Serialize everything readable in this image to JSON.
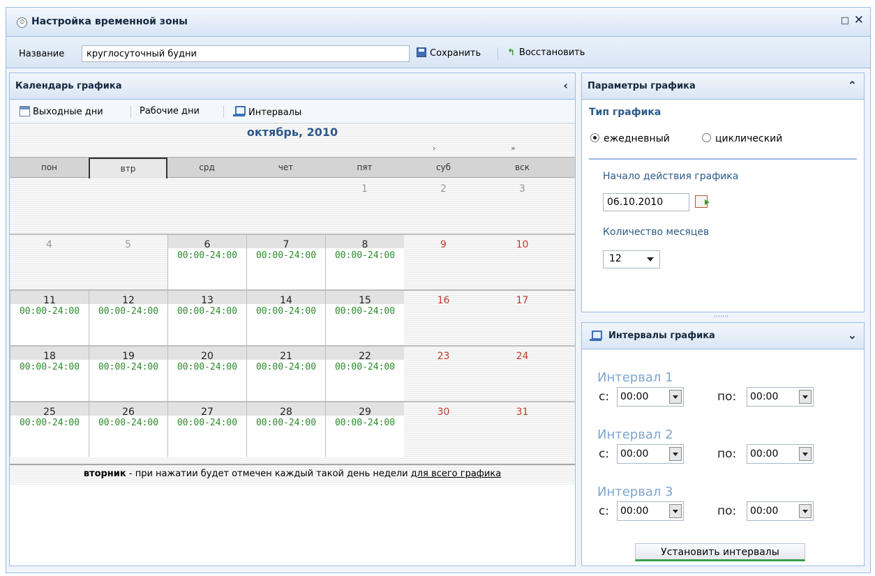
{
  "window": {
    "title": "Настройка временной зоны"
  },
  "toolbar": {
    "name_label": "Название",
    "name_value": "круглосуточный будни",
    "save_label": "Сохранить",
    "restore_label": "Восстановить"
  },
  "calendar_panel": {
    "title": "Календарь графика",
    "tabs": {
      "weekends": "Выходные дни",
      "workdays": "Рабочие дни",
      "intervals": "Интервалы"
    },
    "month": "октябрь, 2010",
    "nav_next": "›",
    "nav_next_year": "»",
    "weekdays": [
      "пон",
      "втр",
      "срд",
      "чет",
      "пят",
      "суб",
      "вск"
    ],
    "selected_weekday_index": 1,
    "rows": [
      [
        {
          "d": "",
          "t": "",
          "k": "empty"
        },
        {
          "d": "",
          "t": "",
          "k": "empty"
        },
        {
          "d": "",
          "t": "",
          "k": "empty"
        },
        {
          "d": "",
          "t": "",
          "k": "empty"
        },
        {
          "d": "1",
          "t": "",
          "k": "other"
        },
        {
          "d": "2",
          "t": "",
          "k": "other"
        },
        {
          "d": "3",
          "t": "",
          "k": "other"
        }
      ],
      [
        {
          "d": "4",
          "t": "",
          "k": "other"
        },
        {
          "d": "5",
          "t": "",
          "k": "other"
        },
        {
          "d": "6",
          "t": "00:00-24:00",
          "k": "work"
        },
        {
          "d": "7",
          "t": "00:00-24:00",
          "k": "work"
        },
        {
          "d": "8",
          "t": "00:00-24:00",
          "k": "work"
        },
        {
          "d": "9",
          "t": "",
          "k": "wkend"
        },
        {
          "d": "10",
          "t": "",
          "k": "wkend"
        }
      ],
      [
        {
          "d": "11",
          "t": "00:00-24:00",
          "k": "work"
        },
        {
          "d": "12",
          "t": "00:00-24:00",
          "k": "work"
        },
        {
          "d": "13",
          "t": "00:00-24:00",
          "k": "work"
        },
        {
          "d": "14",
          "t": "00:00-24:00",
          "k": "work"
        },
        {
          "d": "15",
          "t": "00:00-24:00",
          "k": "work"
        },
        {
          "d": "16",
          "t": "",
          "k": "wkend"
        },
        {
          "d": "17",
          "t": "",
          "k": "wkend"
        }
      ],
      [
        {
          "d": "18",
          "t": "00:00-24:00",
          "k": "work"
        },
        {
          "d": "19",
          "t": "00:00-24:00",
          "k": "work"
        },
        {
          "d": "20",
          "t": "00:00-24:00",
          "k": "work"
        },
        {
          "d": "21",
          "t": "00:00-24:00",
          "k": "work"
        },
        {
          "d": "22",
          "t": "00:00-24:00",
          "k": "work"
        },
        {
          "d": "23",
          "t": "",
          "k": "wkend"
        },
        {
          "d": "24",
          "t": "",
          "k": "wkend"
        }
      ],
      [
        {
          "d": "25",
          "t": "00:00-24:00",
          "k": "work"
        },
        {
          "d": "26",
          "t": "00:00-24:00",
          "k": "work"
        },
        {
          "d": "27",
          "t": "00:00-24:00",
          "k": "work"
        },
        {
          "d": "28",
          "t": "00:00-24:00",
          "k": "work"
        },
        {
          "d": "29",
          "t": "00:00-24:00",
          "k": "work"
        },
        {
          "d": "30",
          "t": "",
          "k": "wkend"
        },
        {
          "d": "31",
          "t": "",
          "k": "wkend"
        }
      ]
    ],
    "hint_bold": "вторник",
    "hint_text": " - при нажатии будет отмечен каждый такой день недели ",
    "hint_link": "для всего графика"
  },
  "params_panel": {
    "title": "Параметры графика",
    "type_section": "Тип графика",
    "radio_daily": "ежедневный",
    "radio_cyclic": "циклический",
    "selected": "daily",
    "start_label": "Начало действия графика",
    "start_value": "06.10.2010",
    "months_label": "Количество месяцев",
    "months_value": "12"
  },
  "intervals_panel": {
    "title": "Интервалы графика",
    "from_label": "с:",
    "to_label": "по:",
    "intervals": [
      {
        "title": "Интервал 1",
        "from": "00:00",
        "to": "00:00"
      },
      {
        "title": "Интервал 2",
        "from": "00:00",
        "to": "00:00"
      },
      {
        "title": "Интервал 3",
        "from": "00:00",
        "to": "00:00"
      }
    ],
    "set_button": "Установить интервалы"
  },
  "colors": {
    "accent": "#2e5a8a",
    "border": "#99bbe8",
    "time_green": "#2a8a2a",
    "weekend_red": "#c0392b"
  }
}
